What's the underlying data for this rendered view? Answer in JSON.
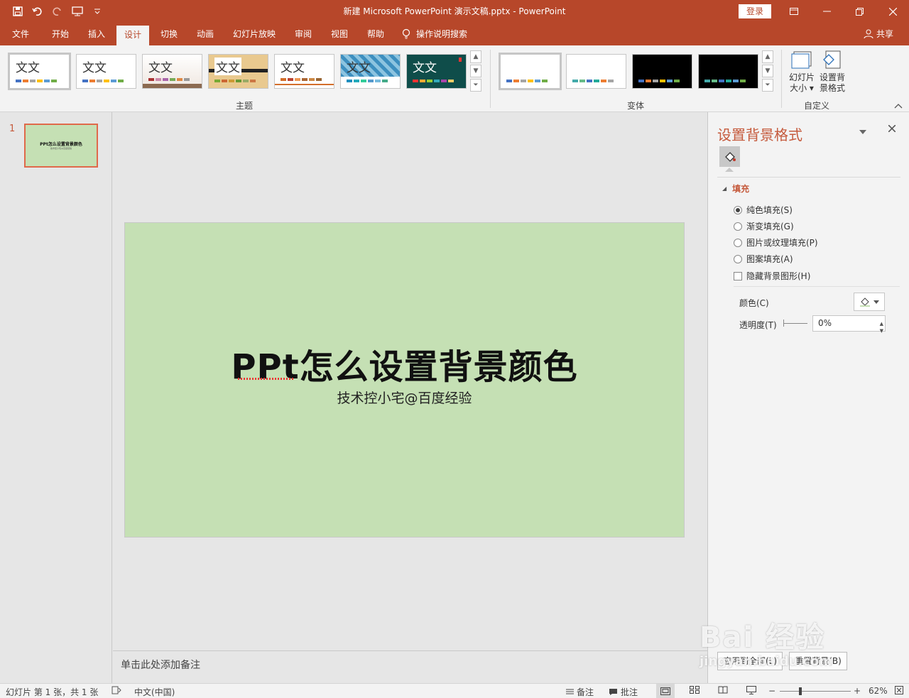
{
  "window": {
    "title": "新建 Microsoft PowerPoint 演示文稿.pptx  -  PowerPoint",
    "login_label": "登录"
  },
  "tabs": [
    {
      "label": "文件"
    },
    {
      "label": "开始"
    },
    {
      "label": "插入"
    },
    {
      "label": "设计"
    },
    {
      "label": "切换"
    },
    {
      "label": "动画"
    },
    {
      "label": "幻灯片放映"
    },
    {
      "label": "审阅"
    },
    {
      "label": "视图"
    },
    {
      "label": "帮助"
    },
    {
      "label": "操作说明搜索"
    }
  ],
  "share_label": "共享",
  "ribbon": {
    "theme_text": "文文",
    "theme_group_label": "主题",
    "variant_group_label": "变体",
    "custom_group_label": "自定义",
    "slide_size_label_1": "幻灯片",
    "slide_size_label_2": "大小",
    "format_bg_label_1": "设置背",
    "format_bg_label_2": "景格式"
  },
  "thumbnail": {
    "slide_number": "1",
    "title": "PPt怎么设置背景颜色",
    "subtitle": "技术控小宅@百度经验"
  },
  "slide": {
    "title": "PPt怎么设置背景颜色",
    "subtitle": "技术控小宅@百度经验",
    "background_color": "#c5e0b4"
  },
  "notes_placeholder": "单击此处添加备注",
  "format_pane": {
    "title": "设置背景格式",
    "section_label": "填充",
    "options": [
      {
        "label": "纯色填充(S)",
        "selected": true
      },
      {
        "label": "渐变填充(G)",
        "selected": false
      },
      {
        "label": "图片或纹理填充(P)",
        "selected": false
      },
      {
        "label": "图案填充(A)",
        "selected": false
      }
    ],
    "hide_bg_graphics_label": "隐藏背景图形(H)",
    "color_label": "颜色(C)",
    "transparency_label": "透明度(T)",
    "transparency_value": "0%",
    "apply_all_label": "应用到全部(L)",
    "reset_label": "重置背景(B)"
  },
  "status": {
    "slide_info": "幻灯片 第 1 张，共 1 张",
    "language": "中文(中国)",
    "notes_label": "备注",
    "comments_label": "批注",
    "zoom": "62%"
  },
  "watermark": {
    "brand": "Bai 经验",
    "url": "jingyan.baidu.com"
  },
  "colors": {
    "accent": "#b7472a",
    "pane_title": "#c55a3c"
  }
}
